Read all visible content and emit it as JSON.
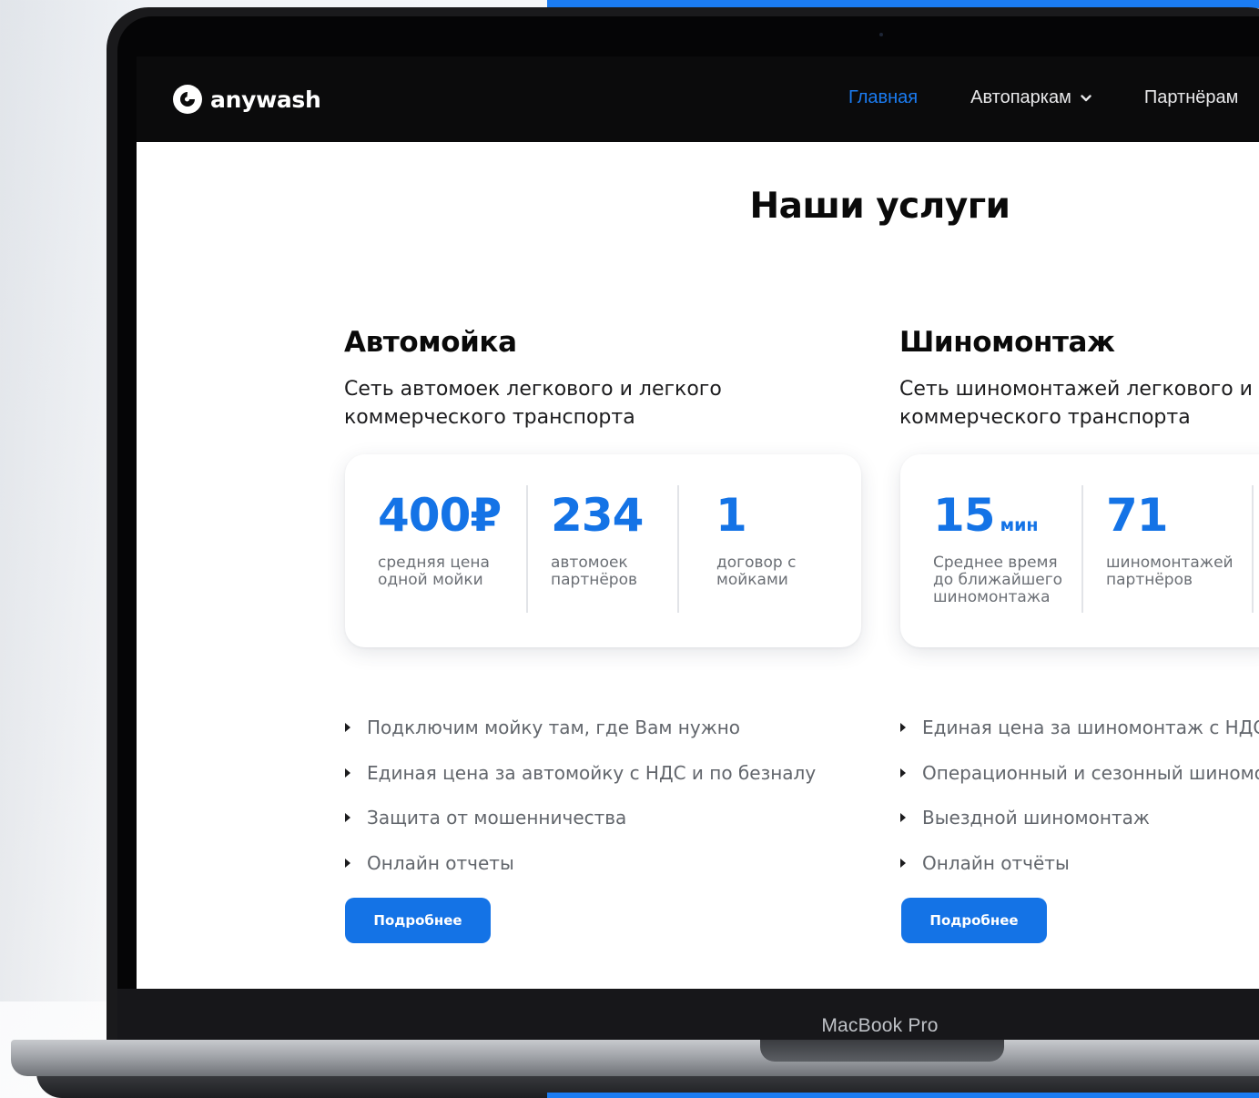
{
  "brand": {
    "name": "anywash",
    "device_label": "MacBook Pro"
  },
  "colors": {
    "accent": "#1473e6",
    "nav_bg": "#0b0b0c",
    "text": "#0a0a0a",
    "muted": "#62666c"
  },
  "nav": {
    "items": [
      {
        "label": "Главная",
        "active": true
      },
      {
        "label": "Автопаркам",
        "has_dropdown": true
      },
      {
        "label": "Партнёрам"
      }
    ]
  },
  "page": {
    "title": "Наши услуги"
  },
  "services": [
    {
      "title": "Автомойка",
      "description_lines": [
        "Сеть автомоек легкового и легкого",
        "коммерческого транспорта"
      ],
      "stats": [
        {
          "value": "400₽",
          "unit": "",
          "label_lines": [
            "средняя цена",
            "одной мойки"
          ]
        },
        {
          "value": "234",
          "unit": "",
          "label_lines": [
            "автомоек",
            "партнёров"
          ]
        },
        {
          "value": "1",
          "unit": "",
          "label_lines": [
            "договор с",
            "мойками"
          ]
        }
      ],
      "bullets": [
        "Подключим мойку там, где Вам нужно",
        "Единая цена за автомойку с НДС и по безналу",
        "Защита от мошенничества",
        "Онлайн отчеты"
      ],
      "button_label": "Подробнее"
    },
    {
      "title": "Шиномонтаж",
      "description_lines": [
        "Сеть шиномонтажей легкового и",
        "коммерческого транспорта"
      ],
      "stats": [
        {
          "value": "15",
          "unit": "мин",
          "label_lines": [
            "Среднее время",
            "до ближайшего",
            "шиномонтажа"
          ]
        },
        {
          "value": "71",
          "unit": "",
          "label_lines": [
            "шиномонтажей",
            "партнёров"
          ]
        }
      ],
      "bullets": [
        "Единая цена за шиномонтаж с НДС и",
        "Операционный и сезонный шиномон",
        "Выездной шиномонтаж",
        "Онлайн отчёты"
      ],
      "button_label": "Подробнее"
    }
  ]
}
